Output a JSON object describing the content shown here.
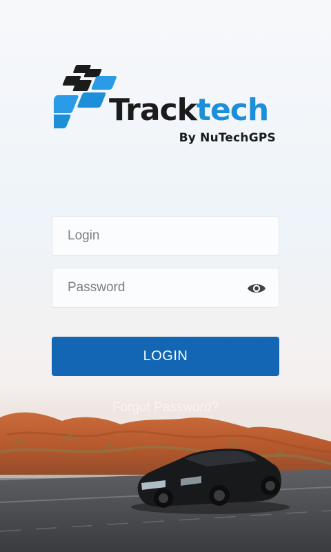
{
  "brand": {
    "name_part1": "Track",
    "name_part2": "tech",
    "tagline": "By NuTechGPS",
    "color_dark": "#1b1b1b",
    "color_blue": "#1d8fd9"
  },
  "form": {
    "login_placeholder": "Login",
    "password_placeholder": "Password",
    "password_toggle_icon": "eye-icon",
    "submit_label": "LOGIN",
    "forgot_label": "Forgot Password?"
  },
  "colors": {
    "primary": "#1266b3"
  }
}
